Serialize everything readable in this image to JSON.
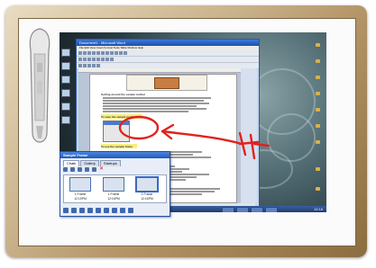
{
  "word": {
    "title": "Document1 - Microsoft Word",
    "menu": "File  Edit  View  Insert  Format  Tools  Table  Window  Help",
    "heading": "Getting around the sample toolbar",
    "section_heading": "To save the sample toolbar",
    "section2_heading": "To use the sample frame",
    "section3_heading": "To add other files",
    "status": "Page 1   Sec 1   1/1"
  },
  "dialog": {
    "title": "Sample Frame",
    "tabs": [
      "Chalk",
      "Gallery",
      "Startups"
    ],
    "thumbs": [
      {
        "label": "1 Frame",
        "time": "12:15PM"
      },
      {
        "label": "1 Frame",
        "time": "12:16PM"
      },
      {
        "label": "1 Frame",
        "time": "12:16PM"
      }
    ],
    "close_glyph": "✕"
  },
  "taskbar": {
    "clock": "12:16"
  },
  "colors": {
    "annotation": "#e0221e",
    "frame": "#b39466",
    "titlebar": "#2159bb"
  }
}
